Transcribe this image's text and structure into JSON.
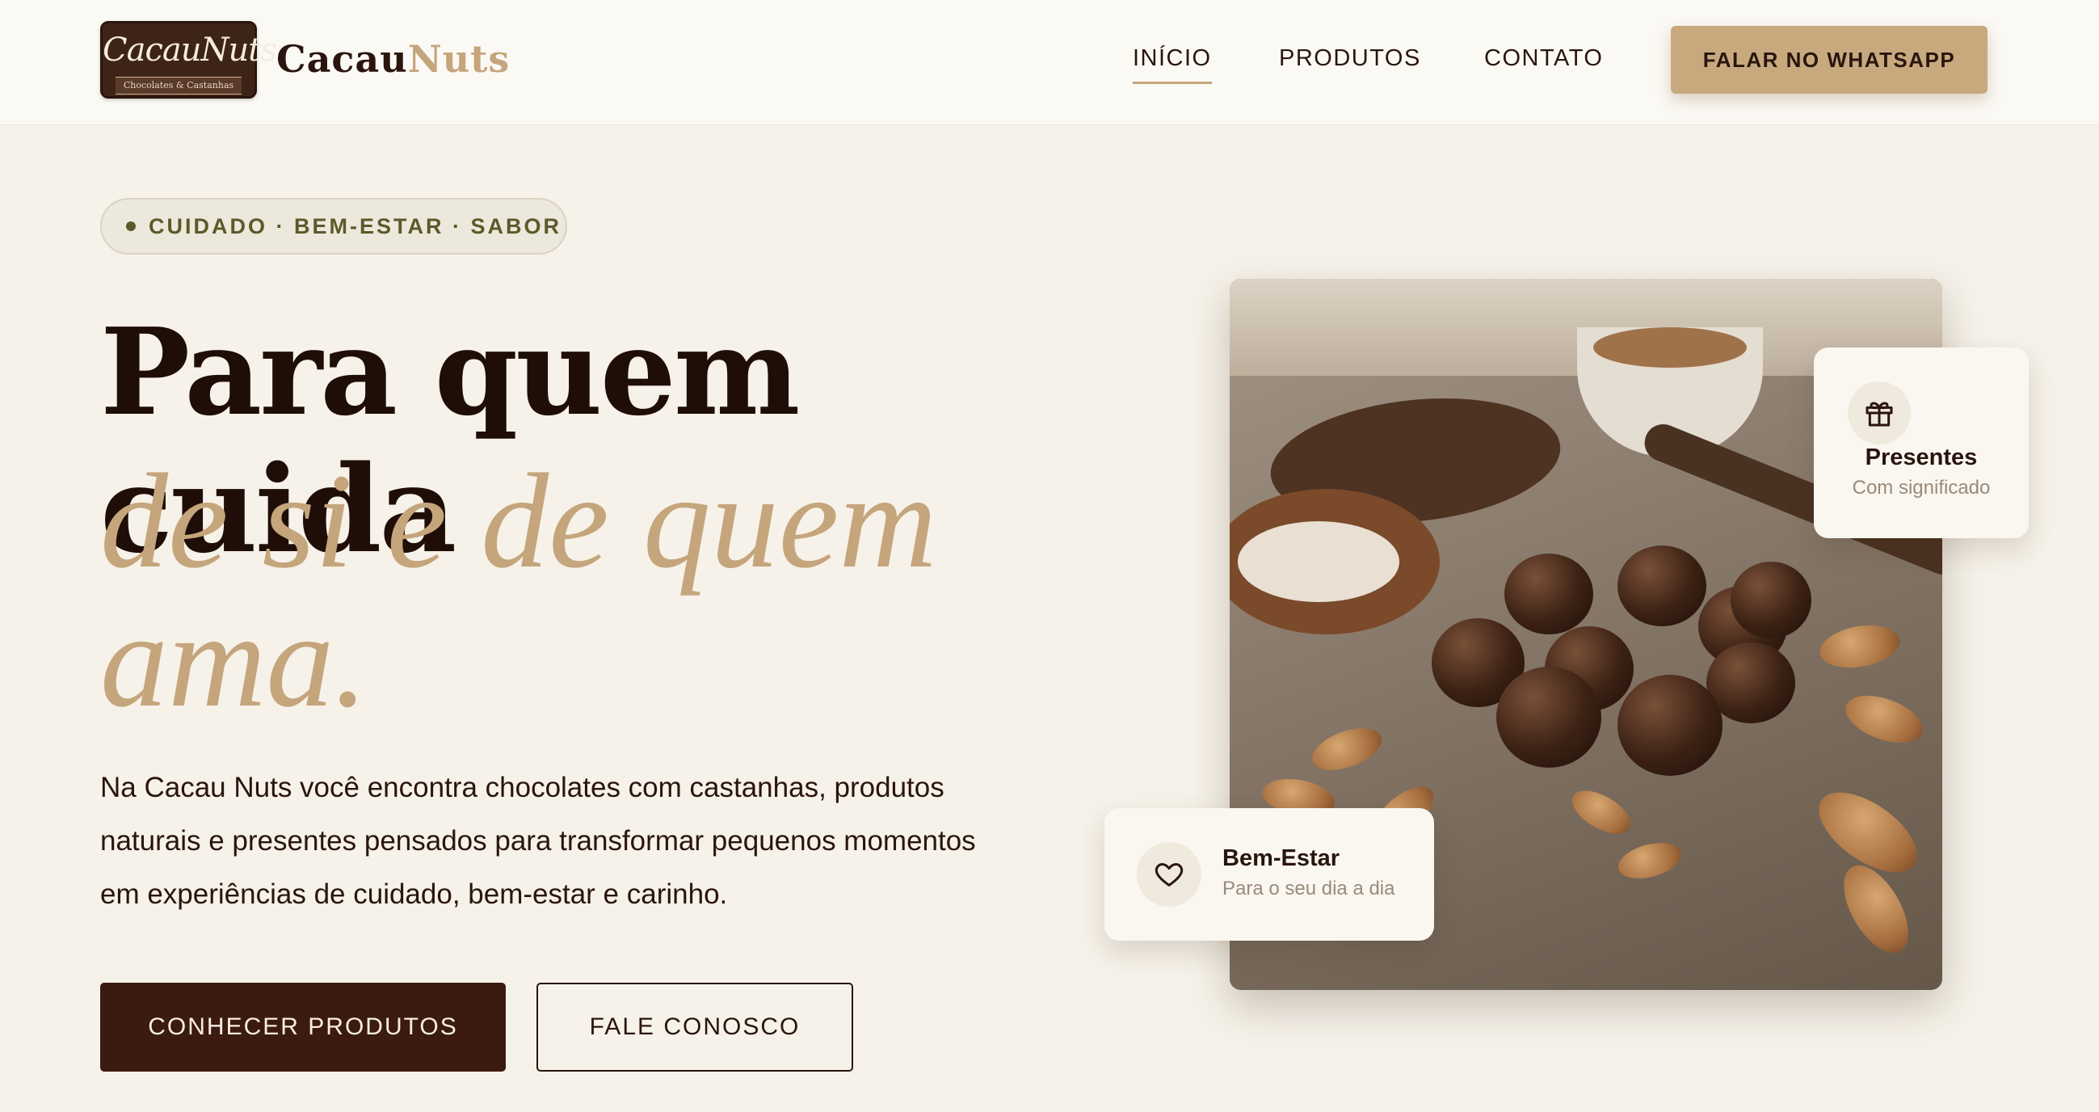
{
  "colors": {
    "accent": "#c5a57c",
    "dark": "#2a150e",
    "primary_button": "#3b1a10",
    "background": "#f6f2e9"
  },
  "header": {
    "logo": {
      "script_text": "CacauNuts",
      "ribbon_text": "Chocolates & Castanhas",
      "icon": "brand-logo"
    },
    "brand_part1": "Cacau",
    "brand_part2": "Nuts",
    "nav": [
      {
        "label": "INÍCIO",
        "active": true
      },
      {
        "label": "PRODUTOS",
        "active": false
      },
      {
        "label": "CONTATO",
        "active": false
      }
    ],
    "cta_label": "FALAR NO WHATSAPP"
  },
  "hero": {
    "tag": "CUIDADO · BEM-ESTAR · SABOR",
    "title_line1": "Para quem cuida",
    "title_line2": "de si e de quem",
    "title_line3": "ama.",
    "lead_line1": "Na Cacau Nuts você encontra chocolates com castanhas, produtos",
    "lead_line2": "naturais e presentes pensados para transformar pequenos momentos",
    "lead_line3": "em experiências de cuidado, bem-estar e carinho.",
    "primary_button": "CONHECER PRODUTOS",
    "secondary_button": "FALE CONOSCO"
  },
  "cards": {
    "presentes": {
      "title": "Presentes",
      "subtitle": "Com significado",
      "icon": "gift-icon"
    },
    "bem_estar": {
      "title": "Bem-Estar",
      "subtitle": "Para o seu dia a dia",
      "icon": "heart-icon"
    }
  }
}
